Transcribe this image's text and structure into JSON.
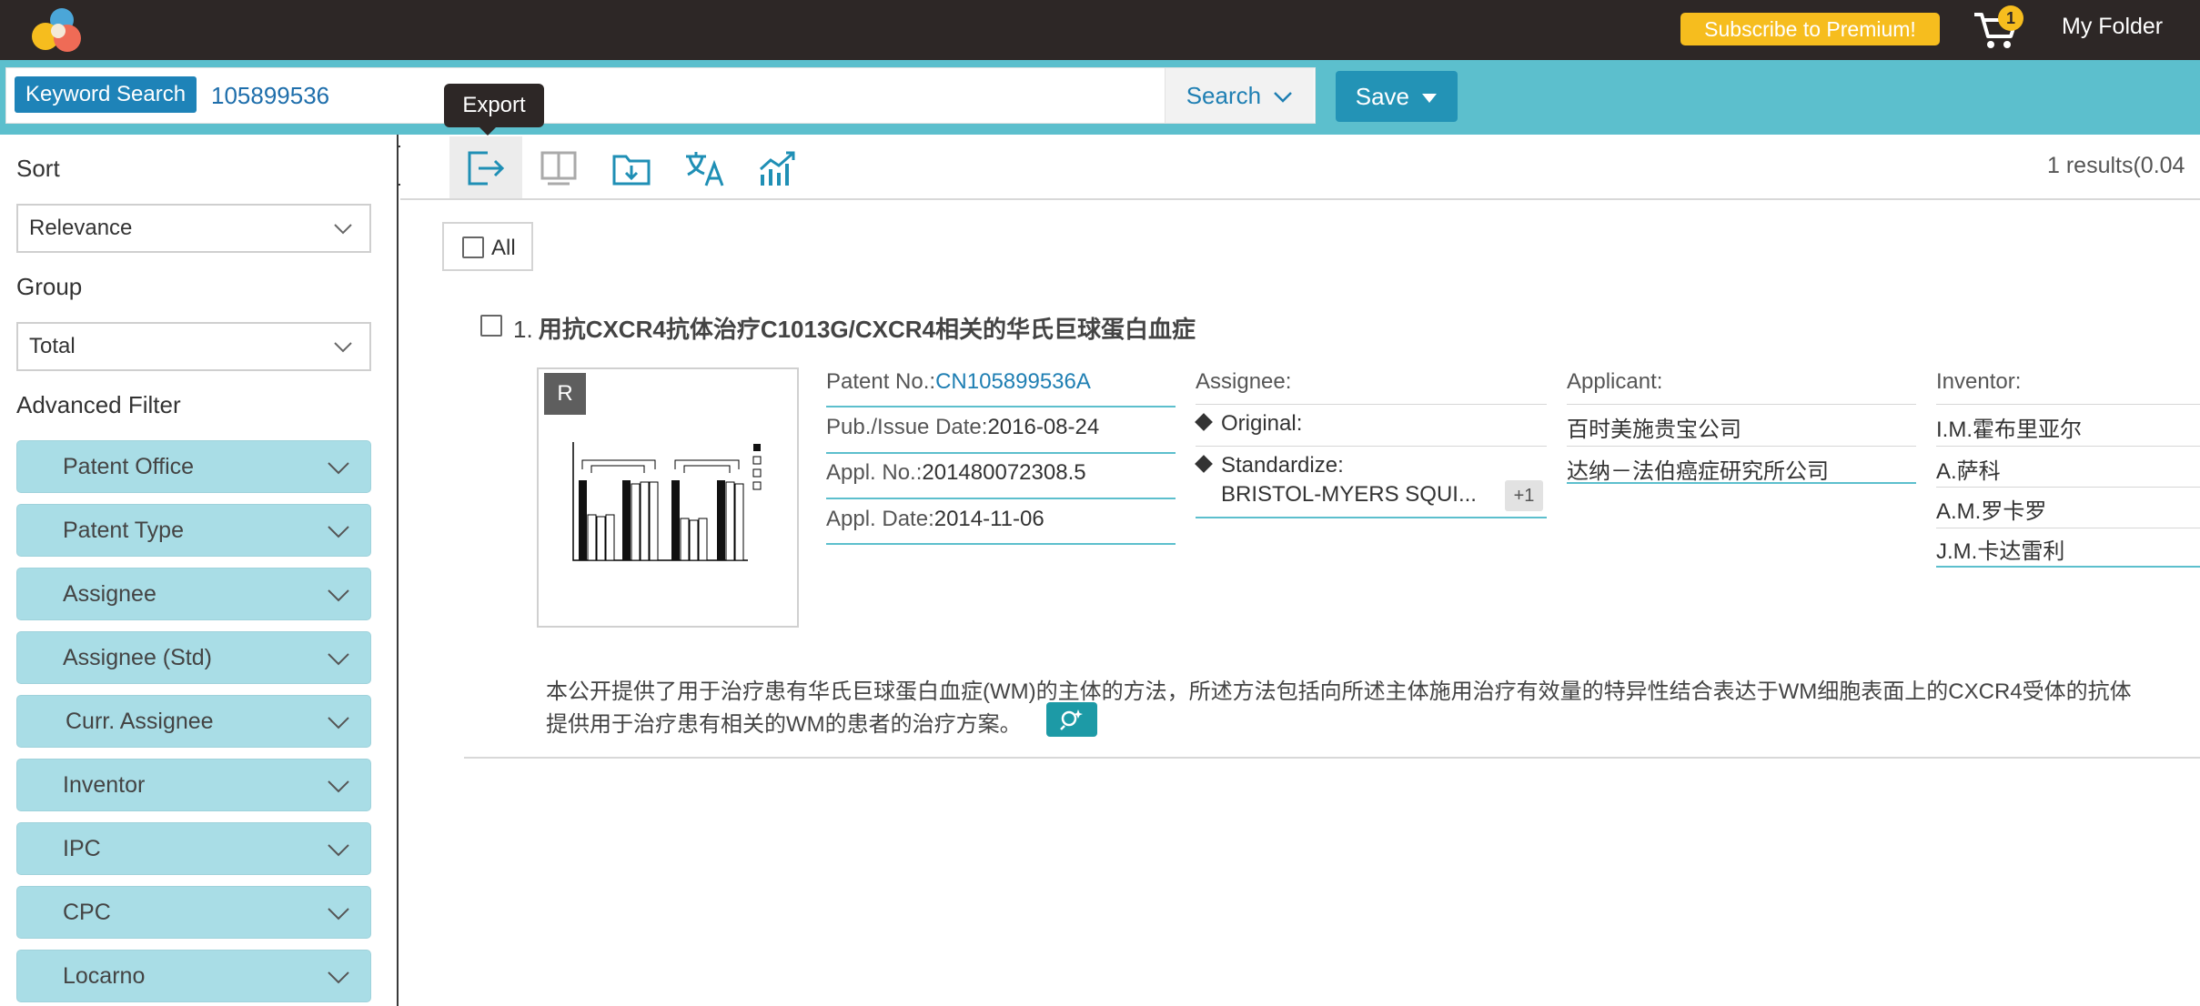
{
  "header": {
    "premium_label": "Subscribe to Premium!",
    "cart_count": "1",
    "my_folder_label": "My Folder"
  },
  "search": {
    "mode_label": "Keyword Search",
    "query": "105899536",
    "search_label": "Search",
    "save_label": "Save"
  },
  "tooltip": {
    "text": "Export"
  },
  "toolbar": {
    "tools": [
      "export-icon",
      "compare-icon",
      "folder-add-icon",
      "translate-icon",
      "analytics-icon"
    ],
    "results_text": "1 results(0.04"
  },
  "sidebar": {
    "sort_label": "Sort",
    "sort_value": "Relevance",
    "group_label": "Group",
    "group_value": "Total",
    "advanced_label": "Advanced Filter",
    "filters": [
      "Patent Office",
      "Patent Type",
      "Assignee",
      "Assignee (Std)",
      "Curr. Assignee",
      "Inventor",
      "IPC",
      "CPC",
      "Locarno"
    ]
  },
  "results": {
    "all_label": "All",
    "items": [
      {
        "index": "1.",
        "title": "用抗CXCR4抗体治疗C1013G/CXCR4相关的华氏巨球蛋白血症",
        "badge": "R",
        "patent_no_label": "Patent No.:",
        "patent_no": "CN105899536A",
        "pub_date_label": "Pub./Issue Date:",
        "pub_date": "2016-08-24",
        "appl_no_label": "Appl. No.:",
        "appl_no": "201480072308.5",
        "appl_date_label": "Appl. Date:",
        "appl_date": "2014-11-06",
        "assignee_label": "Assignee:",
        "original_label": "Original:",
        "standardize_label": "Standardize:",
        "standardize_value": "BRISTOL-MYERS SQUI...",
        "standardize_more": "+1",
        "applicant_label": "Applicant:",
        "applicants": [
          "百时美施贵宝公司",
          "达纳－法伯癌症研究所公司"
        ],
        "inventor_label": "Inventor:",
        "inventors": [
          "I.M.霍布里亚尔",
          "A.萨科",
          "A.M.罗卡罗",
          "J.M.卡达雷利"
        ],
        "abstract_line1": "本公开提供了用于治疗患有华氏巨球蛋白血症(WM)的主体的方法，所述方法包括向所述主体施用治疗有效量的特异性结合表达于WM细胞表面上的CXCR4受体的抗体",
        "abstract_line2": "提供用于治疗患有相关的WM的患者的治疗方案。"
      }
    ]
  },
  "colors": {
    "topbar": "#2d2726",
    "accent_teal": "#5cbfcd",
    "keyword_tag": "#1e83b8",
    "save_button": "#2393b6",
    "premium": "#f6bd1e",
    "filter_bg": "#a9dde6",
    "link": "#1f7fb3"
  }
}
